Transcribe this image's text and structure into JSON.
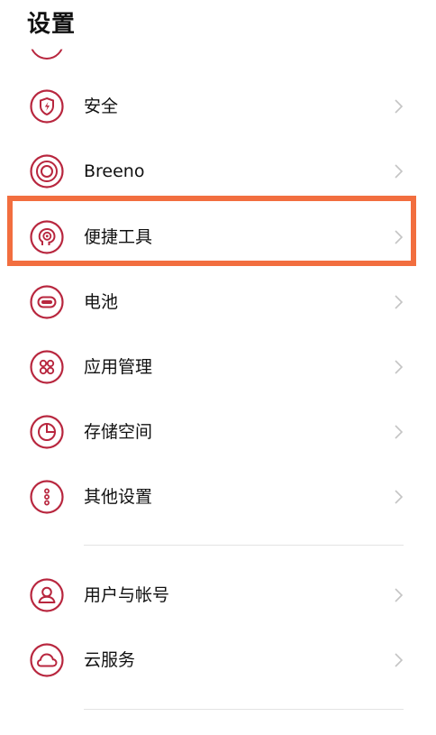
{
  "header": {
    "title": "设置"
  },
  "colors": {
    "accent": "#b8263e",
    "highlight": "#f26e3f",
    "chevron": "#c4c4c4"
  },
  "items": [
    {
      "label": "安全",
      "icon": "shield-bolt-icon"
    },
    {
      "label": "Breeno",
      "icon": "breeno-rings-icon"
    },
    {
      "label": "便捷工具",
      "icon": "convenience-tools-icon"
    },
    {
      "label": "电池",
      "icon": "battery-icon"
    },
    {
      "label": "应用管理",
      "icon": "app-grid-icon"
    },
    {
      "label": "存储空间",
      "icon": "pie-chart-icon"
    },
    {
      "label": "其他设置",
      "icon": "more-dots-icon"
    }
  ],
  "account_items": [
    {
      "label": "用户与帐号",
      "icon": "user-icon"
    },
    {
      "label": "云服务",
      "icon": "cloud-icon"
    }
  ]
}
